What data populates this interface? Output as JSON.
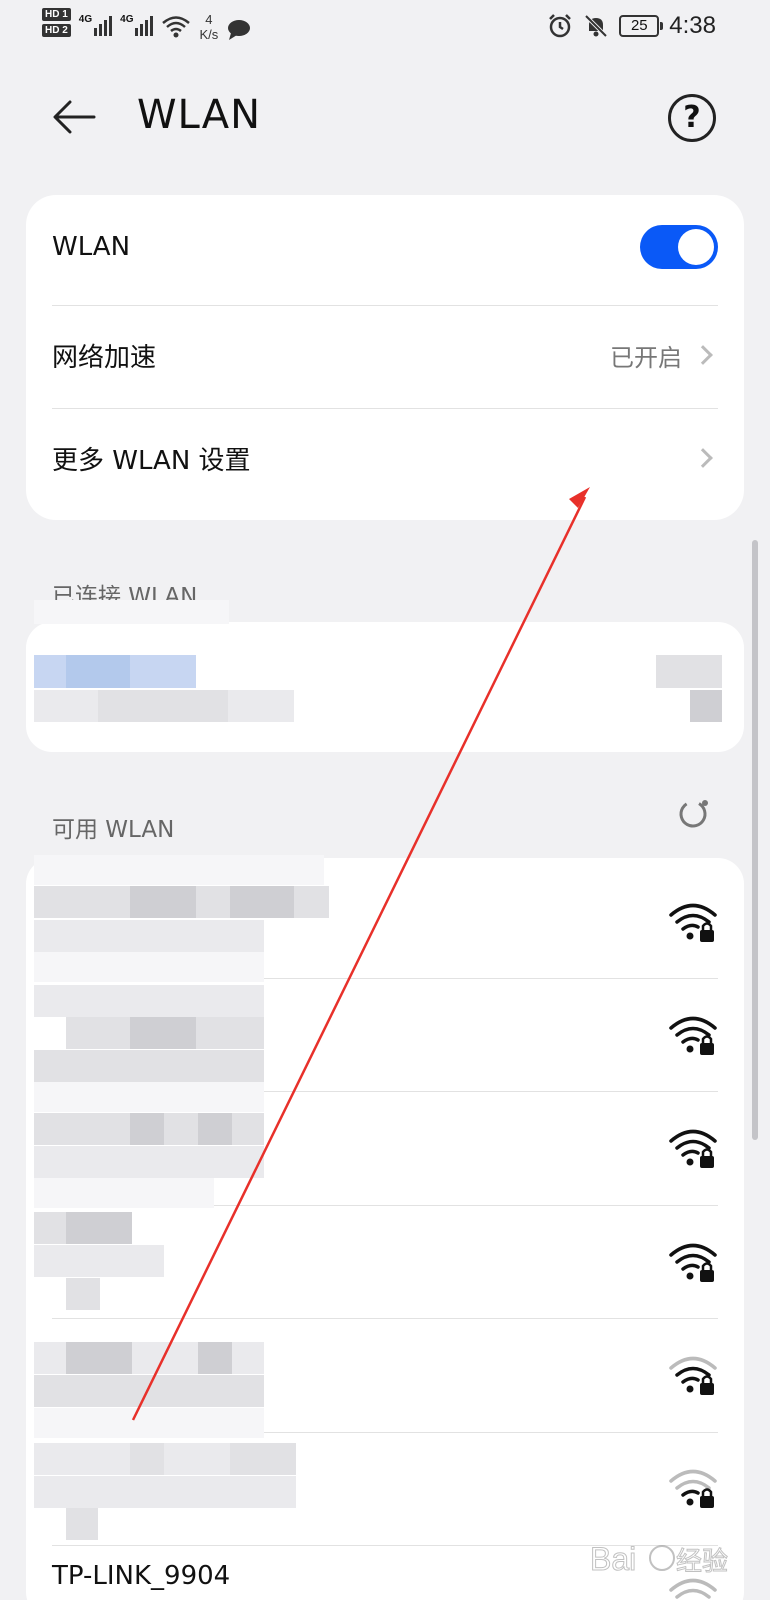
{
  "status": {
    "hd1": "HD 1",
    "hd2": "HD 2",
    "net1": "4G",
    "net2": "4G",
    "speed_value": "4",
    "speed_unit": "K/s",
    "battery": "25",
    "time": "4:38"
  },
  "header": {
    "title": "WLAN"
  },
  "settings": {
    "wlan_label": "WLAN",
    "wlan_on": true,
    "accel_label": "网络加速",
    "accel_value": "已开启",
    "more_label": "更多 WLAN 设置"
  },
  "sections": {
    "connected": "已连接 WLAN",
    "available": "可用 WLAN"
  },
  "networks": {
    "last_visible_name": "TP-LINK_9904"
  },
  "colors": {
    "accent": "#0a59f7",
    "annotation_arrow": "#e8302a"
  },
  "icons": [
    "back-arrow-icon",
    "help-icon",
    "toggle-switch",
    "chevron-right-icon",
    "refresh-icon",
    "wifi-lock-icon"
  ],
  "watermark": "Baidu经验"
}
